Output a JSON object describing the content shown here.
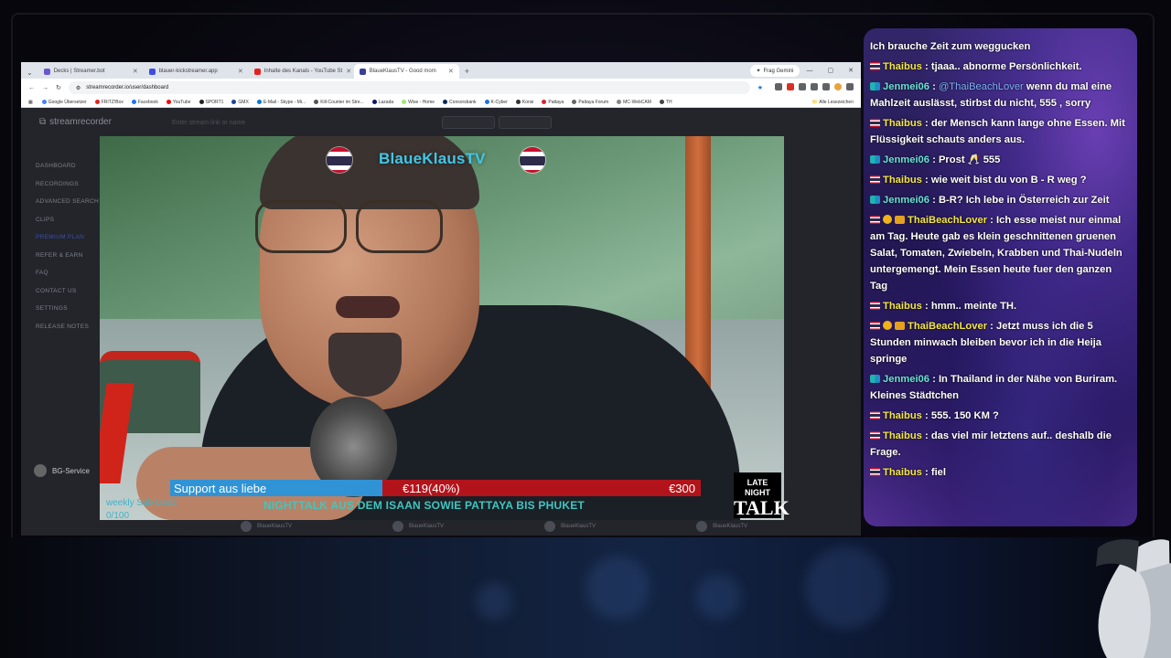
{
  "browser": {
    "tabs": [
      {
        "label": "Decks | Streamer.bot",
        "color": "#6b58c8",
        "active": false
      },
      {
        "label": "blauer-kickstreamer.app",
        "color": "#3d4de3",
        "active": false
      },
      {
        "label": "Inhalte des Kanals - YouTube St",
        "color": "#e52222",
        "active": false
      },
      {
        "label": "BlaueKlausTV - Good mom",
        "color": "#3b3f9a",
        "active": true
      }
    ],
    "gemini": "Frag Gemini",
    "url": "streamrecorder.io/user/dashboard",
    "bookmarks": [
      {
        "label": "Google Übersetzer",
        "color": "#4285f4"
      },
      {
        "label": "FRITZ!Box",
        "color": "#e2231a"
      },
      {
        "label": "Facebook",
        "color": "#1877f2"
      },
      {
        "label": "YouTube",
        "color": "#ff0000"
      },
      {
        "label": "SPORT1",
        "color": "#222222"
      },
      {
        "label": "GMX",
        "color": "#1c449b"
      },
      {
        "label": "E-Mail - Skype - Mi...",
        "color": "#0078d4"
      },
      {
        "label": "Kill-Counter im Stre...",
        "color": "#555555"
      },
      {
        "label": "Lazada",
        "color": "#0f146d"
      },
      {
        "label": "Wise - Home",
        "color": "#9fe870"
      },
      {
        "label": "Consorsbank",
        "color": "#0a2a5a"
      },
      {
        "label": "K-Cyber",
        "color": "#1a73e8"
      },
      {
        "label": "Konsi",
        "color": "#333333"
      },
      {
        "label": "Pattaya",
        "color": "#d23"
      },
      {
        "label": "Pattaya Forum",
        "color": "#666666"
      },
      {
        "label": "MC-WebCAM",
        "color": "#888888"
      },
      {
        "label": "TH",
        "color": "#444444"
      }
    ],
    "all_bookmarks": "Alle Lesezeichen"
  },
  "page": {
    "logo": "streamrecorder",
    "search_placeholder": "Enter stream link or name",
    "nav": [
      {
        "label": "DASHBOARD",
        "highlight": false
      },
      {
        "label": "RECORDINGS",
        "highlight": false
      },
      {
        "label": "ADVANCED SEARCH",
        "highlight": false
      },
      {
        "label": "CLIPS",
        "highlight": false
      },
      {
        "label": "PREMIUM PLAN",
        "highlight": true
      },
      {
        "label": "REFER & EARN",
        "highlight": false
      },
      {
        "label": "FAQ",
        "highlight": false
      },
      {
        "label": "CONTACT US",
        "highlight": false
      },
      {
        "label": "SETTINGS",
        "highlight": false
      },
      {
        "label": "RELEASE NOTES",
        "highlight": false
      }
    ],
    "user": "BG-Service",
    "recordings": [
      "BlaueKlausTV",
      "BlaueKlausTV",
      "BlaueKlausTV",
      "BlaueKlausTV"
    ]
  },
  "overlay": {
    "channel": "BlaueKlausTV",
    "goal_label": "Support aus liebe",
    "goal_current": "€119(40%)",
    "goal_target": "€300",
    "goal_fraction": 0.4,
    "ticker": "NIGHTTALK AUS DEM ISAAN SOWIE PATTAYA BIS PHUKET",
    "sub_goal_line1": "weekly Sub Goal:",
    "sub_goal_line2": "0/100",
    "logo_top": "LATE NIGHT",
    "logo_main": "TALK"
  },
  "chat": {
    "messages": [
      {
        "badges": [],
        "user": "",
        "user_color": "",
        "mention": "",
        "text": "Ich brauche Zeit zum weggucken"
      },
      {
        "badges": [
          "th"
        ],
        "user": "Thaibus",
        "user_color": "yellow",
        "mention": "",
        "text": "tjaaa.. abnorme Persönlichkeit."
      },
      {
        "badges": [
          "at"
        ],
        "user": "Jenmei06",
        "user_color": "teal",
        "mention": "@ThaiBeachLover",
        "text": "wenn du mal eine Mahlzeit auslässt, stirbst du nicht, 555 , sorry"
      },
      {
        "badges": [
          "th"
        ],
        "user": "Thaibus",
        "user_color": "yellow",
        "mention": "",
        "text": "der Mensch kann lange ohne Essen. Mit Flüssigkeit schauts anders aus."
      },
      {
        "badges": [
          "at"
        ],
        "user": "Jenmei06",
        "user_color": "teal",
        "mention": "",
        "text": "Prost 🥂 555"
      },
      {
        "badges": [
          "th"
        ],
        "user": "Thaibus",
        "user_color": "yellow",
        "mention": "",
        "text": "wie weit bist du von B - R weg ?"
      },
      {
        "badges": [
          "at"
        ],
        "user": "Jenmei06",
        "user_color": "teal",
        "mention": "",
        "text": "B-R? Ich lebe in Österreich zur Zeit"
      },
      {
        "badges": [
          "th",
          "gold",
          "crown"
        ],
        "user": "ThaiBeachLover",
        "user_color": "yellow",
        "mention": "",
        "text": "Ich esse meist nur einmal am Tag. Heute gab es klein geschnittenen gruenen Salat, Tomaten, Zwiebeln, Krabben und Thai-Nudeln untergemengt. Mein Essen heute fuer den ganzen Tag"
      },
      {
        "badges": [
          "th"
        ],
        "user": "Thaibus",
        "user_color": "yellow",
        "mention": "",
        "text": "hmm.. meinte TH."
      },
      {
        "badges": [
          "th",
          "gold",
          "crown"
        ],
        "user": "ThaiBeachLover",
        "user_color": "yellow",
        "mention": "",
        "text": "Jetzt muss ich die 5 Stunden minwach bleiben bevor ich in die Heija springe"
      },
      {
        "badges": [
          "at"
        ],
        "user": "Jenmei06",
        "user_color": "teal",
        "mention": "",
        "text": "In Thailand in der Nähe von Buriram. Kleines Städtchen"
      },
      {
        "badges": [
          "th"
        ],
        "user": "Thaibus",
        "user_color": "yellow",
        "mention": "",
        "text": "555. 150 KM ?"
      },
      {
        "badges": [
          "th"
        ],
        "user": "Thaibus",
        "user_color": "yellow",
        "mention": "",
        "text": "das viel mir letztens auf.. deshalb die Frage."
      },
      {
        "badges": [
          "th"
        ],
        "user": "Thaibus",
        "user_color": "yellow",
        "mention": "",
        "text": "fiel"
      }
    ]
  }
}
